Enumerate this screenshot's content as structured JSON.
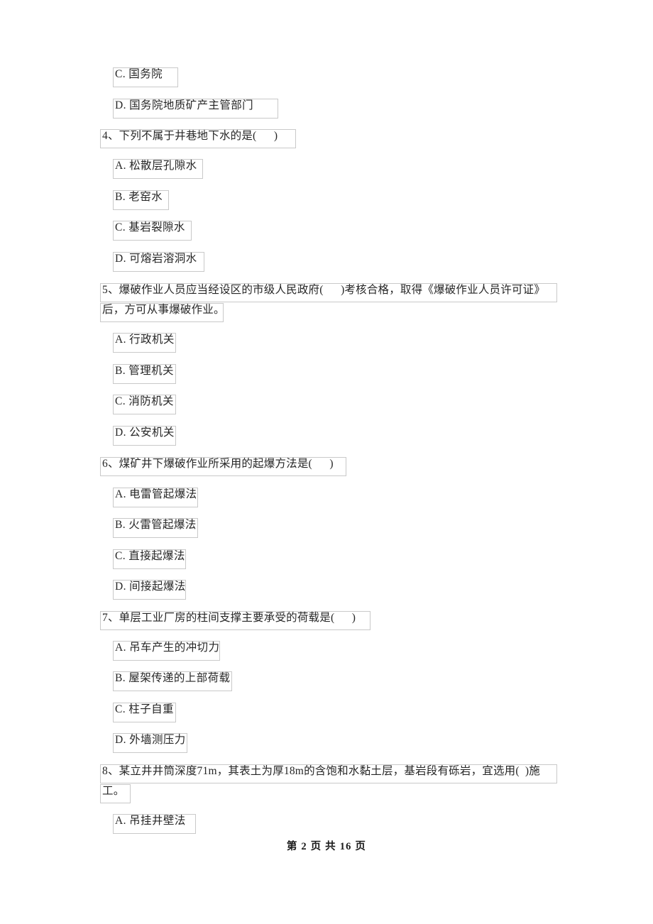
{
  "document": {
    "type": "exam-question-paper",
    "language": "zh-CN",
    "page_background": "#ffffff",
    "text_color": "#262626",
    "fragment_border_color": "#c9c9c9"
  },
  "content": {
    "continued_options": [
      {
        "id": "c3",
        "label": "C. 国务院"
      },
      {
        "id": "d3",
        "label": "D. 国务院地质矿产主管部门"
      }
    ],
    "questions": [
      {
        "number": "4",
        "stem_lines": [
          "4、下列不属于井巷地下水的是(      )"
        ],
        "options": [
          "A. 松散层孔隙水",
          "B. 老窑水",
          "C. 基岩裂隙水",
          "D. 可熔岩溶洞水"
        ]
      },
      {
        "number": "5",
        "stem_lines": [
          "5、爆破作业人员应当经设区的市级人民政府(      )考核合格，取得《爆破作业人员许可证》",
          "后，方可从事爆破作业。"
        ],
        "options": [
          "A. 行政机关",
          "B. 管理机关",
          "C. 消防机关",
          "D. 公安机关"
        ]
      },
      {
        "number": "6",
        "stem_lines": [
          "6、煤矿井下爆破作业所采用的起爆方法是(      )"
        ],
        "options": [
          "A. 电雷管起爆法",
          "B. 火雷管起爆法",
          "C. 直接起爆法",
          "D. 间接起爆法"
        ]
      },
      {
        "number": "7",
        "stem_lines": [
          "7、单层工业厂房的柱间支撑主要承受的荷载是(      )"
        ],
        "options": [
          "A. 吊车产生的冲切力",
          "B. 屋架传递的上部荷载",
          "C. 柱子自重",
          "D. 外墙测压力"
        ]
      },
      {
        "number": "8",
        "stem_lines": [
          "8、某立井井筒深度71m，其表土为厚18m的含饱和水黏土层，基岩段有砾岩，宜选用(  )施",
          "工。"
        ],
        "options": [
          "A. 吊挂井壁法"
        ]
      }
    ]
  },
  "footer": {
    "text": "第 2 页 共 16 页",
    "page_number": "2",
    "total_pages": "16"
  }
}
